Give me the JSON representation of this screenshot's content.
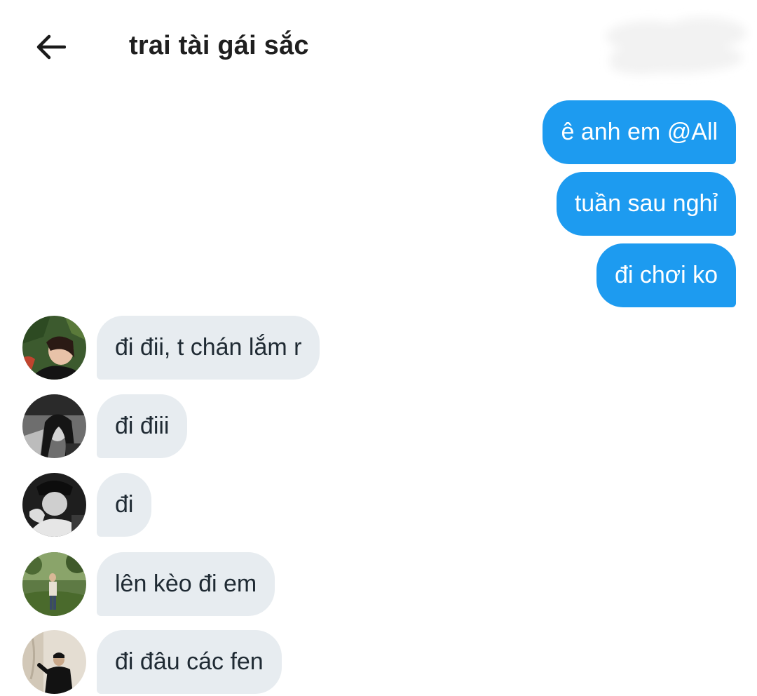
{
  "header": {
    "back_icon": "arrow-left-icon",
    "title": "trai tài gái sắc"
  },
  "messages": {
    "outgoing": [
      "ê anh em @All",
      "tuần sau nghỉ",
      "đi chơi ko"
    ],
    "incoming": [
      {
        "text": "đi đii, t chán lắm r"
      },
      {
        "text": "đi điii"
      },
      {
        "text": "đi"
      },
      {
        "text": "lên kèo đi em"
      },
      {
        "text": "đi đâu các fen"
      }
    ]
  },
  "colors": {
    "outgoing_bubble": "#1d9bf0",
    "incoming_bubble": "#e7ecf0",
    "background": "#ffffff"
  }
}
